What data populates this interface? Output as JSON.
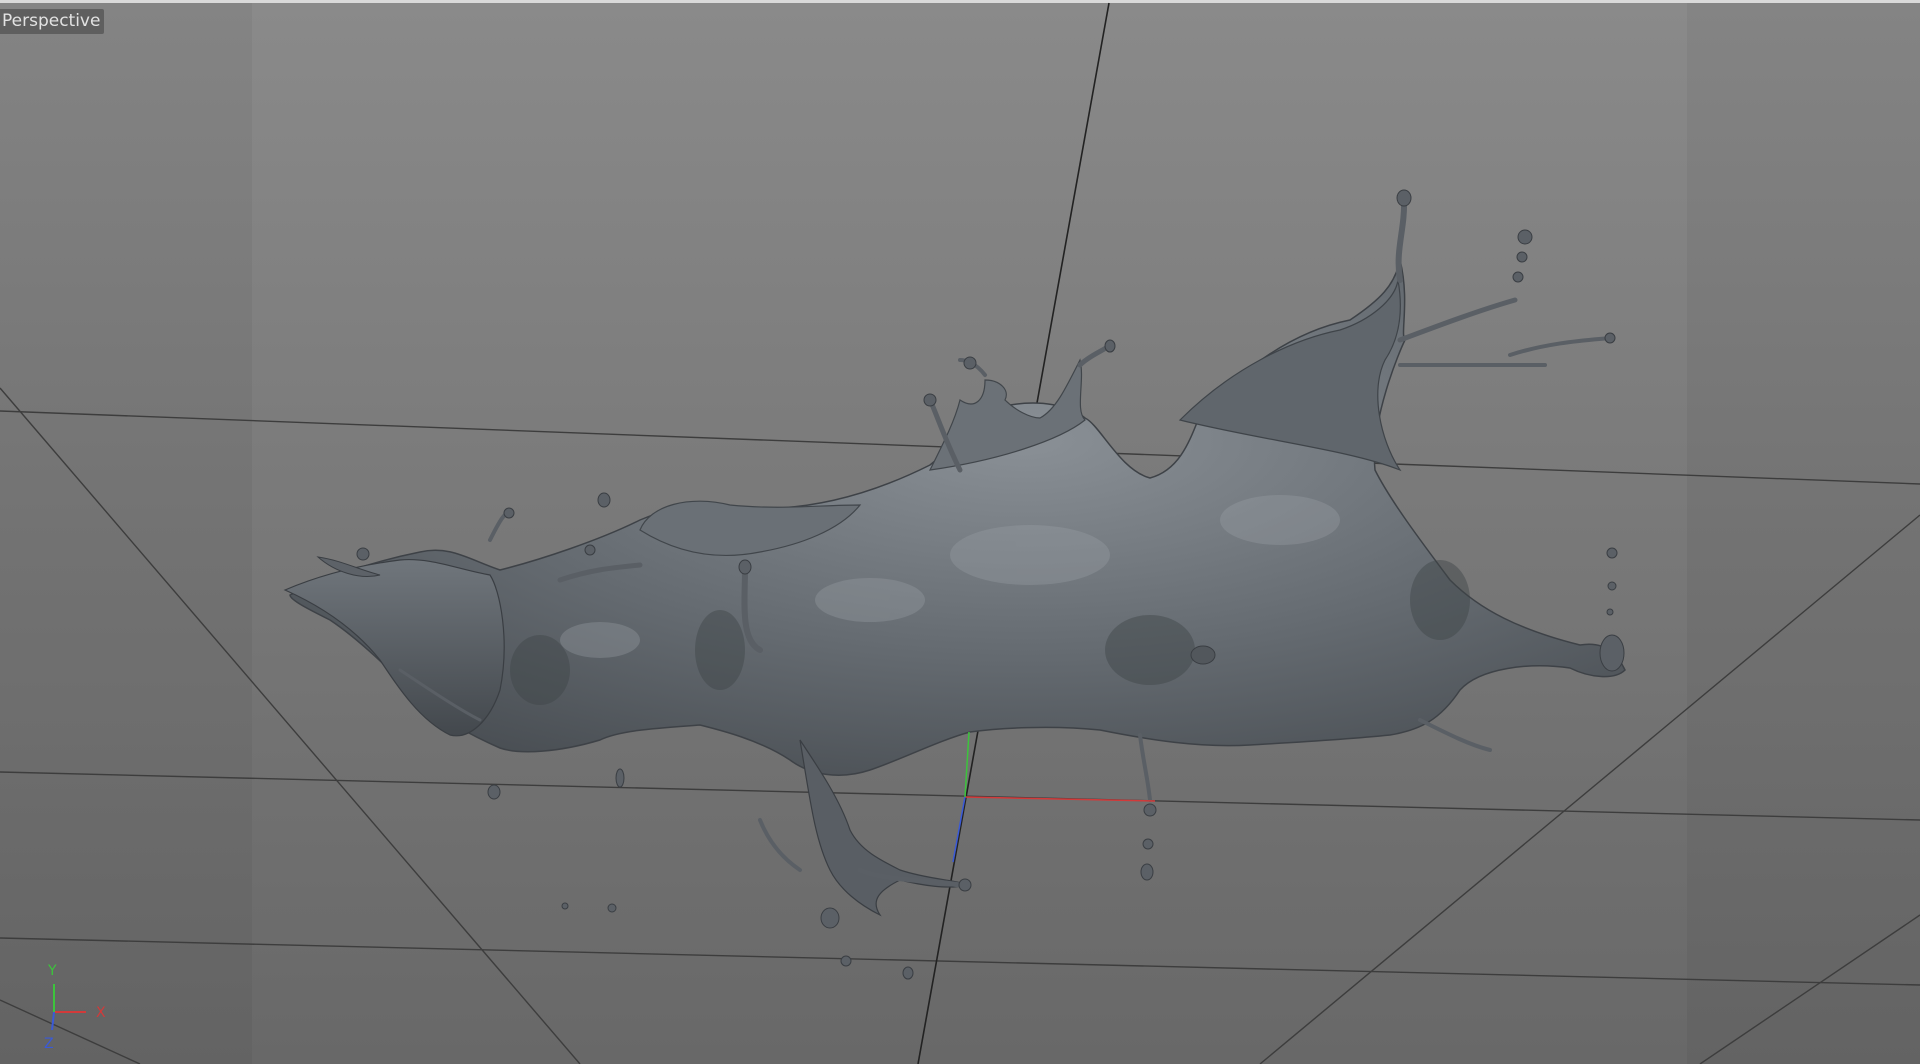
{
  "viewport": {
    "view_label": "Perspective",
    "background_color": "#7c7c7c"
  },
  "axis_gizmo": {
    "x_label": "X",
    "y_label": "Y",
    "z_label": "Z",
    "x_color": "#d23a3a",
    "y_color": "#3cc43c",
    "z_color": "#3a5ad8"
  },
  "scene": {
    "object": "liquid-splash-mesh",
    "mesh_color": "#5c6166",
    "grid_line_color": "#3d3d3d"
  }
}
